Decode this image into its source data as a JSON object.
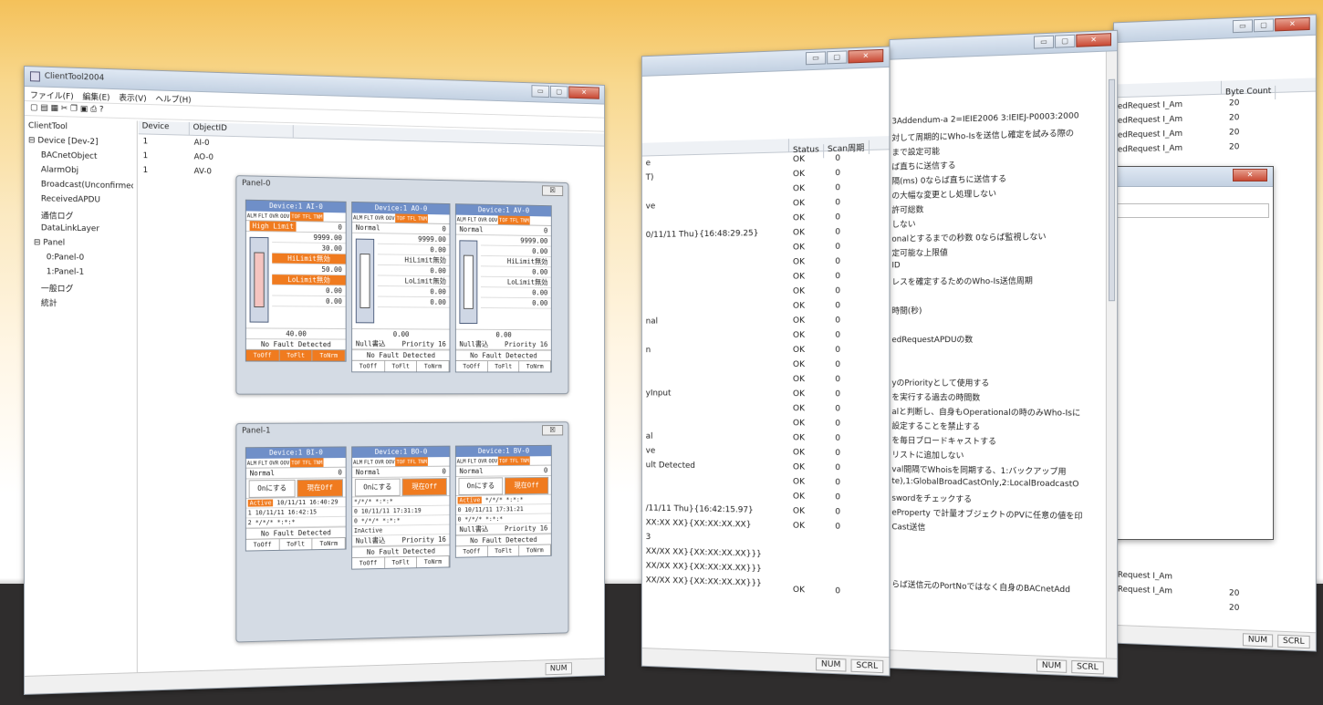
{
  "w1": {
    "title": "ClientTool2004",
    "menu": [
      "ファイル(F)",
      "編集(E)",
      "表示(V)",
      "ヘルプ(H)"
    ],
    "tree": [
      "ClientTool",
      "⊟ Device [Dev-2]",
      "BACnetObject",
      "AlarmObj",
      "Broadcast(UnconfirmedService)",
      "ReceivedAPDU",
      "通信ログ",
      "DataLinkLayer",
      "⊟ Panel",
      "0:Panel-0",
      "1:Panel-1",
      "一般ログ",
      "統計"
    ],
    "cols": [
      "Device",
      "ObjectID"
    ],
    "devices": [
      "1",
      "1",
      "1"
    ],
    "objects": [
      "AI-0",
      "AO-0",
      "AV-0"
    ],
    "status": "NUM"
  },
  "p0": {
    "title": "Panel-0",
    "close": "☒",
    "d": [
      {
        "h": "Device:1 AI-0",
        "state": "High Limit",
        "val": "0",
        "a": "9999.00",
        "b": "30.00",
        "c": "HiLimit無効",
        "d": "50.00",
        "e": "LoLimit無効",
        "f": "0.00",
        "g": "0.00",
        "v": "40.00",
        "fault": "No Fault Detected"
      },
      {
        "h": "Device:1 AO-0",
        "state": "Normal",
        "val": "0",
        "a": "9999.00",
        "b": "0.00",
        "c": "HiLimit無効",
        "d": "0.00",
        "e": "LoLimit無効",
        "f": "0.00",
        "g": "0.00",
        "v": "0.00",
        "p1": "Null書込",
        "p2": "Priority 16",
        "fault": "No Fault Detected"
      },
      {
        "h": "Device:1 AV-0",
        "state": "Normal",
        "val": "0",
        "a": "9999.00",
        "b": "0.00",
        "c": "HiLimit無効",
        "d": "0.00",
        "e": "LoLimit無効",
        "f": "0.00",
        "g": "0.00",
        "v": "0.00",
        "p1": "Null書込",
        "p2": "Priority 16",
        "fault": "No Fault Detected"
      }
    ],
    "flags": [
      "ALM",
      "FLT",
      "OVR",
      "OOV",
      "TOF",
      "TFL",
      "TNM"
    ],
    "btns": [
      "ToOff",
      "ToFlt",
      "ToNrm"
    ]
  },
  "p1": {
    "title": "Panel-1",
    "close": "☒",
    "d": [
      {
        "h": "Device:1 BI-0",
        "state": "Normal",
        "val": "0",
        "on": "Onにする",
        "off": "現在Off",
        "l1": "Active",
        "l1b": "10/11/11 16:40:29",
        "l2": "1",
        "l2b": "10/11/11 16:42:15",
        "l3": "2",
        "l3b": "*/*/* *:*:*",
        "fault": "No Fault Detected"
      },
      {
        "h": "Device:1 BO-0",
        "state": "Normal",
        "val": "0",
        "on": "Onにする",
        "off": "現在Off",
        "l2b": "*/*/* *:*:*",
        "l3": "0",
        "l3b": "10/11/11 17:31:19",
        "l4": "0",
        "l4b": "*/*/* *:*:*",
        "l5": "InActive",
        "p1": "Null書込",
        "p2": "Priority 16",
        "fault": "No Fault Detected"
      },
      {
        "h": "Device:1 BV-0",
        "state": "Normal",
        "val": "0",
        "on": "Onにする",
        "off": "現在Off",
        "l1": "Active",
        "l1b": "*/*/* *:*:*",
        "l2": "0",
        "l2b": "10/11/11 17:31:21",
        "l3": "0",
        "l3b": "*/*/* *:*:*",
        "p1": "Null書込",
        "p2": "Priority 16",
        "fault": "No Fault Detected"
      }
    ],
    "flags": [
      "ALM",
      "FLT",
      "OVR",
      "OOV",
      "TOF",
      "TFL",
      "TNM"
    ],
    "btns": [
      "ToOff",
      "ToFlt",
      "ToNrm"
    ]
  },
  "w2": {
    "cols": [
      "Status",
      "Scan周期"
    ],
    "left": [
      "e",
      "T)",
      "",
      "ve",
      "",
      "0/11/11 Thu}{16:48:29.25}",
      "",
      "",
      "",
      "",
      "",
      "nal",
      "",
      "n",
      "",
      "",
      "yInput",
      "",
      "",
      "al",
      "ve",
      "ult Detected",
      "",
      "",
      "/11/11 Thu}{16:42:15.97}",
      "XX:XX XX}{XX:XX:XX.XX}",
      "3",
      "XX/XX XX}{XX:XX:XX.XX}}}",
      "XX/XX XX}{XX:XX:XX.XX}}}",
      "XX/XX XX}{XX:XX:XX.XX}}}"
    ],
    "ok": [
      "OK",
      "OK",
      "OK",
      "OK",
      "OK",
      "OK",
      "OK",
      "OK",
      "OK",
      "OK",
      "OK",
      "OK",
      "OK",
      "OK",
      "OK",
      "OK",
      "OK",
      "OK",
      "OK",
      "OK",
      "OK",
      "OK",
      "OK",
      "OK",
      "OK",
      "OK"
    ],
    "ok_zero": "0",
    "last_ok": "OK",
    "last_zero": "0",
    "status": [
      "NUM",
      "SCRL"
    ]
  },
  "w3": {
    "lines": [
      "3Addendum-a 2=IEIE2006 3:IEIEJ-P0003:2000",
      "対して周期的にWho-Isを送信し確定を試みる際の",
      "まで設定可能",
      "ば直ちに送信する",
      "隔(ms) 0ならば直ちに送信する",
      "の大幅な変更とし処理しない",
      "許可総数",
      "しない",
      "onalとするまでの秒数 0ならば監視しない",
      "定可能な上限値",
      "ID",
      "レスを確定するためのWho-Is送信周期",
      "",
      "時間(秒)",
      "",
      "edRequestAPDUの数",
      "",
      "",
      "yのPriorityとして使用する",
      "を実行する過去の時間数",
      "alと判断し、自身もOperationalの時のみWho-Isに",
      "設定することを禁止する",
      "を毎日ブロードキャストする",
      "リストに追加しない",
      "val間隔でWhoisを同期する、1:バックアップ用",
      "te),1:GlobalBroadCastOnly,2:LocalBroadcastO",
      "swordをチェックする",
      "eProperty で計量オブジェクトのPVに任意の値を印",
      "Cast送信",
      "",
      "",
      "",
      "らば送信元のPortNoではなく自身のBACnetAdd"
    ],
    "status": [
      "NUM",
      "SCRL"
    ]
  },
  "w4": {
    "col": "Byte Count",
    "rows": [
      "edRequest I_Am",
      "edRequest I_Am",
      "edRequest I_Am",
      "edRequest I_Am"
    ],
    "bytes": [
      "20",
      "20",
      "20",
      "20"
    ],
    "rows2": [
      "Request I_Am",
      "Request I_Am"
    ],
    "bytes2": [
      "20",
      "20"
    ],
    "status": [
      "NUM",
      "SCRL"
    ]
  },
  "dlg": {
    "close": "✕"
  }
}
